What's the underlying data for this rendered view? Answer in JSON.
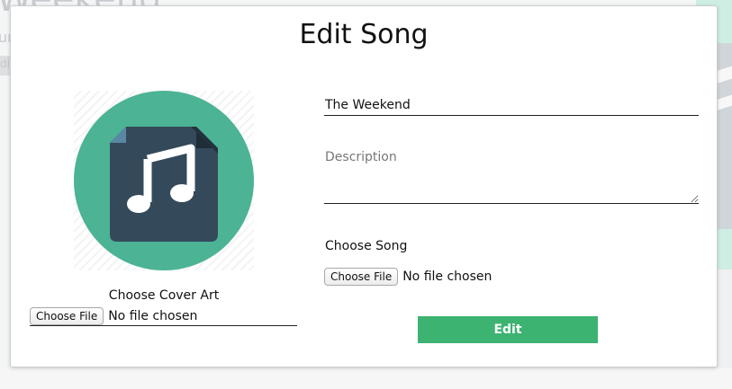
{
  "background": {
    "title": "Weekend",
    "subtitle": "ur",
    "tag": "di"
  },
  "modal": {
    "title": "Edit Song",
    "cover": {
      "icon": "music-file-icon",
      "label": "Choose Cover Art",
      "file_button": "Choose File",
      "file_status": "No file chosen"
    },
    "form": {
      "title_value": "The Weekend",
      "description_placeholder": "Description",
      "description_value": "",
      "song_label": "Choose Song",
      "song_file_button": "Choose File",
      "song_file_status": "No file chosen",
      "submit_label": "Edit"
    }
  },
  "colors": {
    "accent": "#3cb371",
    "cover_circle": "#4cb395",
    "file_icon": "#344a5b",
    "file_fold": "#5a87a3"
  }
}
